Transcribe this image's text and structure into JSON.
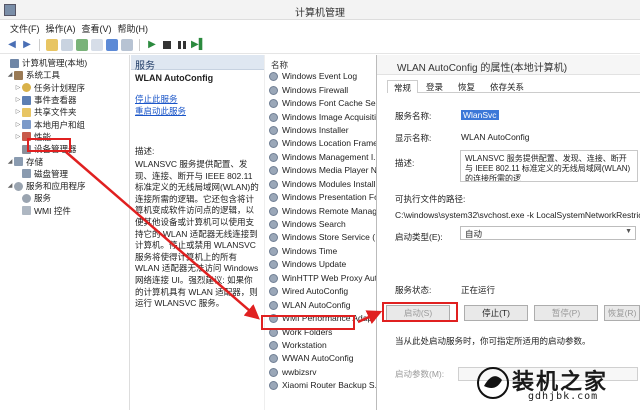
{
  "window": {
    "title": "计算机管理"
  },
  "menu": [
    "文件(F)",
    "操作(A)",
    "查看(V)",
    "帮助(H)"
  ],
  "toolbar_icons": [
    "back-arrow",
    "forward-arrow",
    "folder",
    "properties",
    "refresh",
    "export",
    "help",
    "view",
    "play",
    "stop",
    "pause",
    "restart"
  ],
  "tree": [
    {
      "label": "计算机管理(本地)",
      "icon": "computer-icon",
      "twisty": "",
      "indent": 0
    },
    {
      "label": "系统工具",
      "icon": "tools-icon",
      "twisty": "◢",
      "indent": 1
    },
    {
      "label": "任务计划程序",
      "icon": "clock-icon",
      "twisty": "▷",
      "indent": 2
    },
    {
      "label": "事件查看器",
      "icon": "event-log-icon",
      "twisty": "▷",
      "indent": 2
    },
    {
      "label": "共享文件夹",
      "icon": "folder-icon",
      "twisty": "▷",
      "indent": 2
    },
    {
      "label": "本地用户和组",
      "icon": "users-icon",
      "twisty": "▷",
      "indent": 2
    },
    {
      "label": "性能",
      "icon": "performance-icon",
      "twisty": "▷",
      "indent": 2
    },
    {
      "label": "设备管理器",
      "icon": "device-icon",
      "twisty": "",
      "indent": 2
    },
    {
      "label": "存储",
      "icon": "storage-icon",
      "twisty": "◢",
      "indent": 1
    },
    {
      "label": "磁盘管理",
      "icon": "disk-icon",
      "twisty": "",
      "indent": 2
    },
    {
      "label": "服务和应用程序",
      "icon": "apps-icon",
      "twisty": "◢",
      "indent": 1
    },
    {
      "label": "服务",
      "icon": "gear-icon",
      "twisty": "",
      "indent": 2
    },
    {
      "label": "WMI 控件",
      "icon": "wmi-icon",
      "twisty": "",
      "indent": 2
    }
  ],
  "middle": {
    "header": "服务",
    "service_title": "WLAN AutoConfig",
    "stop_link": "停止此服务",
    "restart_link": "重启动此服务",
    "desc_label": "描述:",
    "description": "WLANSVC 服务提供配置、发现、连接、断开与 IEEE 802.11 标准定义的无线局域网(WLAN)的连接所需的逻辑。它还包含将计算机变成软件访问点的逻辑，以便其他设备或计算机可以使用支持它的 WLAN 适配器无线连接到计算机。停止或禁用 WLANSVC 服务将使得计算机上的所有 WLAN 适配器无法访问 Windows 网络连接 UI。强烈建议: 如果你的计算机具有 WLAN 适配器，则运行 WLANSVC 服务。"
  },
  "services": {
    "column": "名称",
    "rows": [
      "Windows Event Log",
      "Windows Firewall",
      "Windows Font Cache Ser...",
      "Windows Image Acquisiti",
      "Windows Installer",
      "Windows Location Frame",
      "Windows Management I...",
      "Windows Media Player N",
      "Windows Modules Install",
      "Windows Presentation Fo",
      "Windows Remote Manag",
      "Windows Search",
      "Windows Store Service (",
      "Windows Time",
      "Windows Update",
      "WinHTTP Web Proxy Aut...",
      "Wired AutoConfig",
      "WLAN AutoConfig",
      "WMI Performance Adapt",
      "Work Folders",
      "Workstation",
      "WWAN AutoConfig",
      "wwbizsrv",
      "Xiaomi Router Backup S..."
    ]
  },
  "dialog": {
    "title": "WLAN AutoConfig 的属性(本地计算机)",
    "tabs": [
      "常规",
      "登录",
      "恢复",
      "依存关系"
    ],
    "service_name_label": "服务名称:",
    "service_name": "WlanSvc",
    "display_name_label": "显示名称:",
    "display_name": "WLAN AutoConfig",
    "description_label": "描述:",
    "description": "WLANSVC 服务提供配置、发现、连接、断开与 IEEE 802.11 标准定义的无线局域网(WLAN)的连接所需的逻",
    "path_label": "可执行文件的路径:",
    "path": "C:\\windows\\system32\\svchost.exe -k LocalSystemNetworkRestricte",
    "startup_label": "启动类型(E):",
    "startup_value": "自动",
    "status_label": "服务状态:",
    "status_value": "正在运行",
    "start_button": "启动(S)",
    "stop_button": "停止(T)",
    "pause_button": "暂停(P)",
    "resume_button": "恢复(R)",
    "hint": "当从此处启动服务时，你可指定所适用的启动参数。",
    "param_label": "启动参数(M):"
  },
  "watermark": {
    "cn": "装机之家",
    "en": "gdhjbk.com"
  },
  "colors": {
    "highlight": "#e02020",
    "link": "#1a55c8",
    "selection": "#3c78d8"
  }
}
